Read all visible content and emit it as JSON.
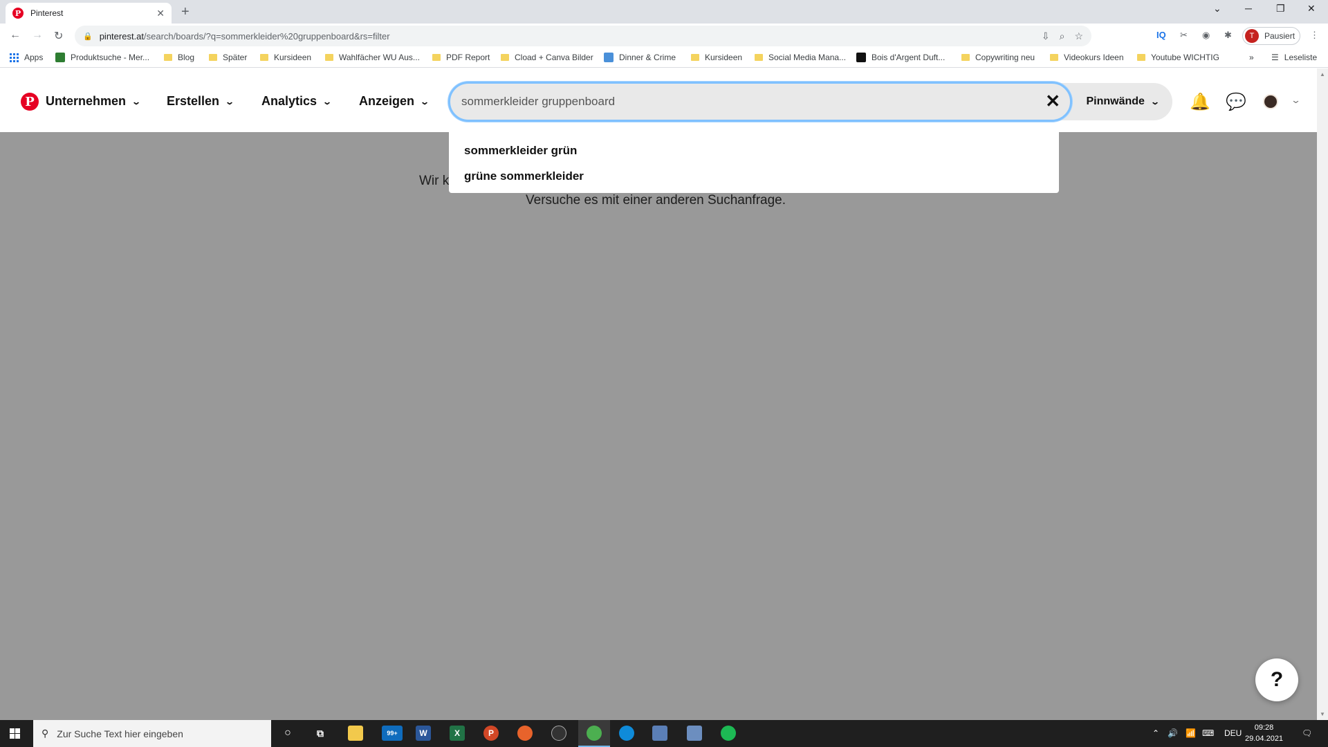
{
  "browser": {
    "tab_title": "Pinterest",
    "new_tab": "+",
    "url_host": "pinterest.at",
    "url_path": "/search/boards/?q=sommerkleider%20gruppenboard&rs=filter",
    "profile_initial": "T",
    "profile_status": "Pausiert",
    "bookmarks": [
      "Apps",
      "Produktsuche - Mer...",
      "Blog",
      "Später",
      "Kursideen",
      "Wahlfächer WU Aus...",
      "PDF Report",
      "Cload + Canva Bilder",
      "Dinner & Crime",
      "Kursideen",
      "Social Media Mana...",
      "Bois d'Argent Duft...",
      "Copywriting neu",
      "Videokurs Ideen",
      "Youtube WICHTIG"
    ],
    "reading_list": "Leseliste"
  },
  "header": {
    "nav": [
      "Unternehmen",
      "Erstellen",
      "Analytics",
      "Anzeigen"
    ],
    "search_query": "sommerkleider gruppenboard",
    "filter_label": "Pinnwände"
  },
  "suggestions": [
    "sommerkleider grün",
    "grüne sommerkleider"
  ],
  "empty_state": {
    "line1": "Wir k",
    "line2": "Versuche es mit einer anderen Suchanfrage."
  },
  "help_label": "?",
  "taskbar": {
    "search_placeholder": "Zur Suche Text hier eingeben",
    "mail_badge": "99+",
    "language": "DEU",
    "time": "09:28",
    "date": "29.04.2021"
  },
  "colors": {
    "pinterest_red": "#e60023",
    "search_focus": "#7fc1ff",
    "overlay": "rgba(0,0,0,0.4)"
  }
}
